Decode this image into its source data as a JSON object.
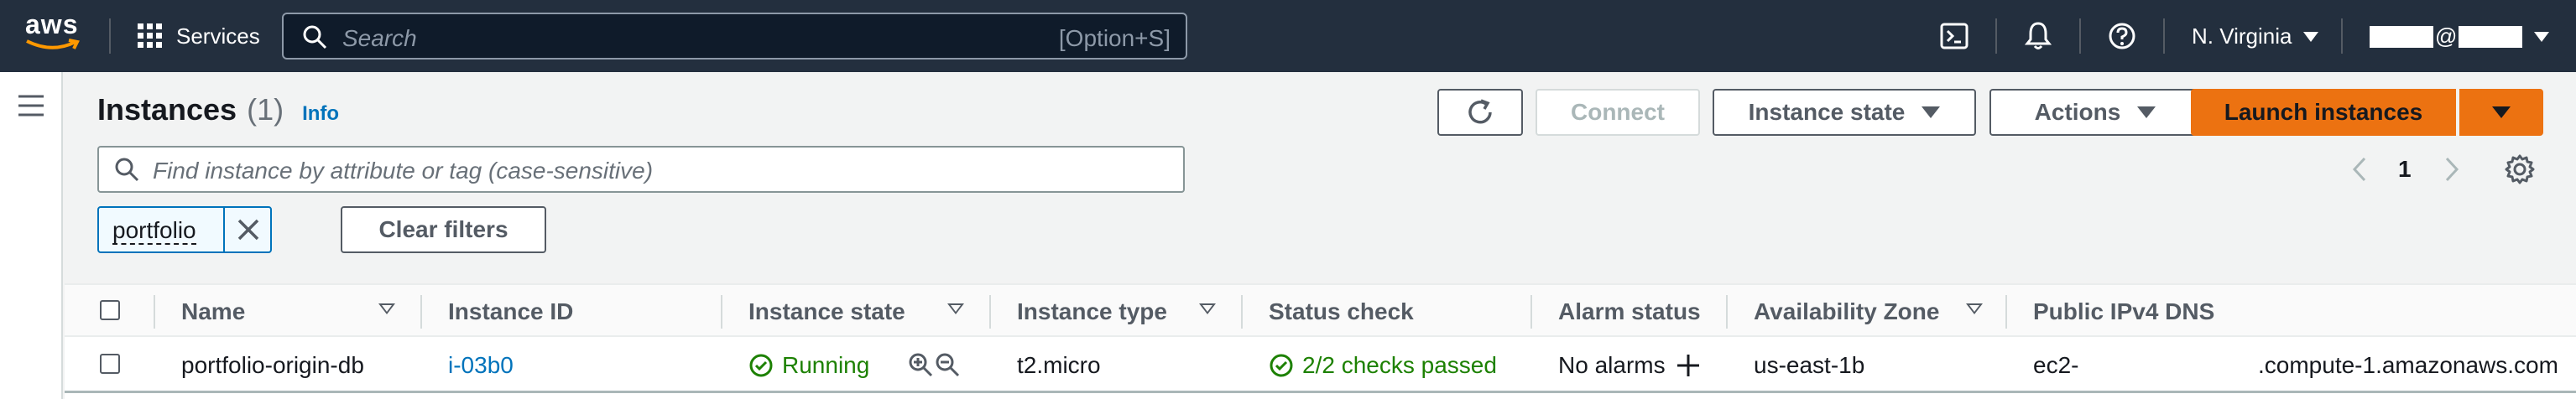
{
  "topnav": {
    "logo_text": "aws",
    "services_label": "Services",
    "search_placeholder": "Search",
    "search_shortcut": "[Option+S]",
    "region": "N. Virginia",
    "account_label": "@"
  },
  "header": {
    "title": "Instances",
    "count": "(1)",
    "info_link": "Info"
  },
  "actions": {
    "connect_label": "Connect",
    "instance_state_label": "Instance state",
    "actions_label": "Actions",
    "launch_label": "Launch instances"
  },
  "filter": {
    "placeholder": "Find instance by attribute or tag (case-sensitive)",
    "token": "portfolio",
    "clear_label": "Clear filters"
  },
  "pagination": {
    "page": "1"
  },
  "table": {
    "columns": [
      "Name",
      "Instance ID",
      "Instance state",
      "Instance type",
      "Status check",
      "Alarm status",
      "Availability Zone",
      "Public IPv4 DNS"
    ],
    "rows": [
      {
        "name": "portfolio-origin-db",
        "instance_id": "i-03b0",
        "state": "Running",
        "type": "t2.micro",
        "status_check": "2/2 checks passed",
        "alarm": "No alarms",
        "az": "us-east-1b",
        "dns_prefix": "ec2-",
        "dns_suffix": ".compute-1.amazonaws.com"
      }
    ]
  },
  "colors": {
    "nav_bg": "#232f3e",
    "primary": "#ec7211",
    "link": "#0073bb",
    "success": "#1d8102"
  }
}
